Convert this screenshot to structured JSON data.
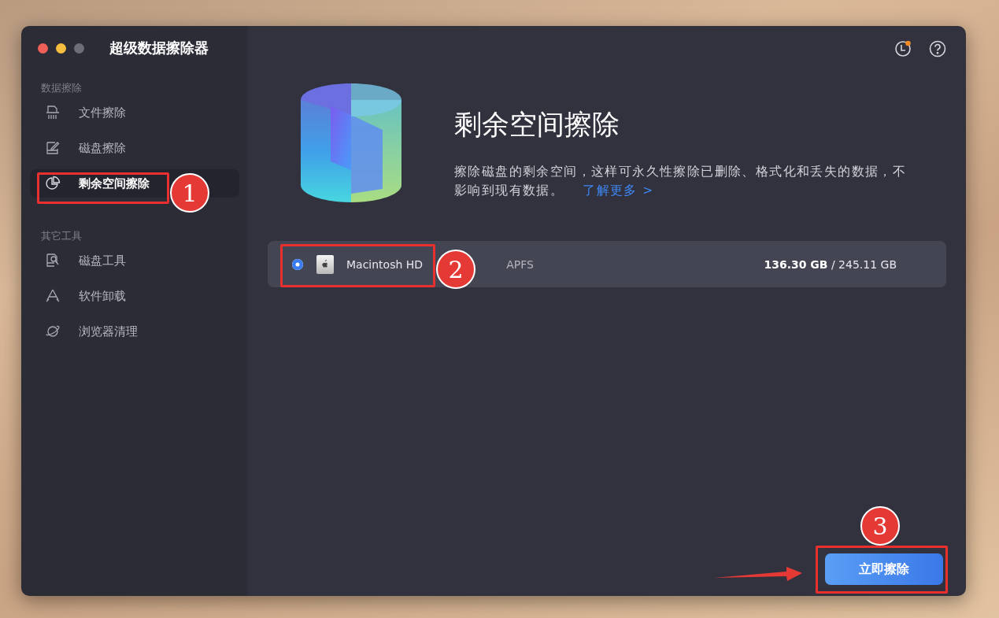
{
  "window": {
    "title": "超级数据擦除器",
    "history_notification": true
  },
  "sidebar": {
    "sections": [
      {
        "heading": "数据擦除",
        "items": [
          {
            "label": "文件擦除",
            "selected": false
          },
          {
            "label": "磁盘擦除",
            "selected": false
          },
          {
            "label": "剩余空间擦除",
            "selected": true
          }
        ]
      },
      {
        "heading": "其它工具",
        "items": [
          {
            "label": "磁盘工具",
            "selected": false
          },
          {
            "label": "软件卸载",
            "selected": false
          },
          {
            "label": "浏览器清理",
            "selected": false
          }
        ]
      }
    ]
  },
  "main": {
    "title": "剩余空间擦除",
    "description": "擦除磁盘的剩余空间，这样可永久性擦除已删除、格式化和丢失的数据，不影响到现有数据。",
    "link": "了解更多 >"
  },
  "drives": [
    {
      "name": "Macintosh HD",
      "selected": true,
      "format": "APFS",
      "capacity": "**136.30 GB** / 245.11 GB"
    }
  ],
  "action_button": "立即擦除",
  "annotations": [
    {
      "label": "1"
    },
    {
      "label": "2"
    },
    {
      "label": "3"
    }
  ]
}
